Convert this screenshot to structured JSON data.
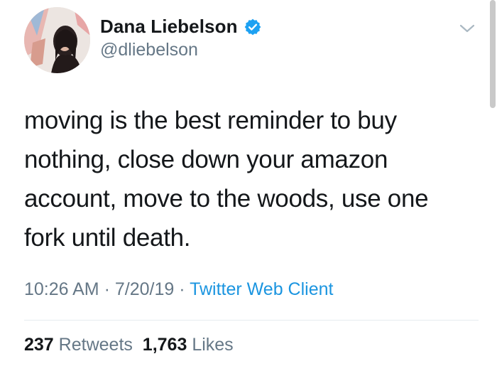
{
  "user": {
    "name": "Dana Liebelson",
    "handle": "@dliebelson",
    "verified": true
  },
  "tweet": {
    "text": "moving is the best reminder to buy nothing, close down your amazon account, move to the woods, use one fork until death.",
    "time": "10:26 AM",
    "date": "7/20/19",
    "separator": "·",
    "client": "Twitter Web Client"
  },
  "stats": {
    "retweets_count": "237",
    "retweets_label": "Retweets",
    "likes_count": "1,763",
    "likes_label": "Likes"
  },
  "icons": {
    "verified": "verified-badge-icon",
    "menu": "chevron-down-icon"
  },
  "colors": {
    "link": "#1b95e0",
    "secondary_text": "#657786",
    "verified_badge": "#1da1f2"
  }
}
